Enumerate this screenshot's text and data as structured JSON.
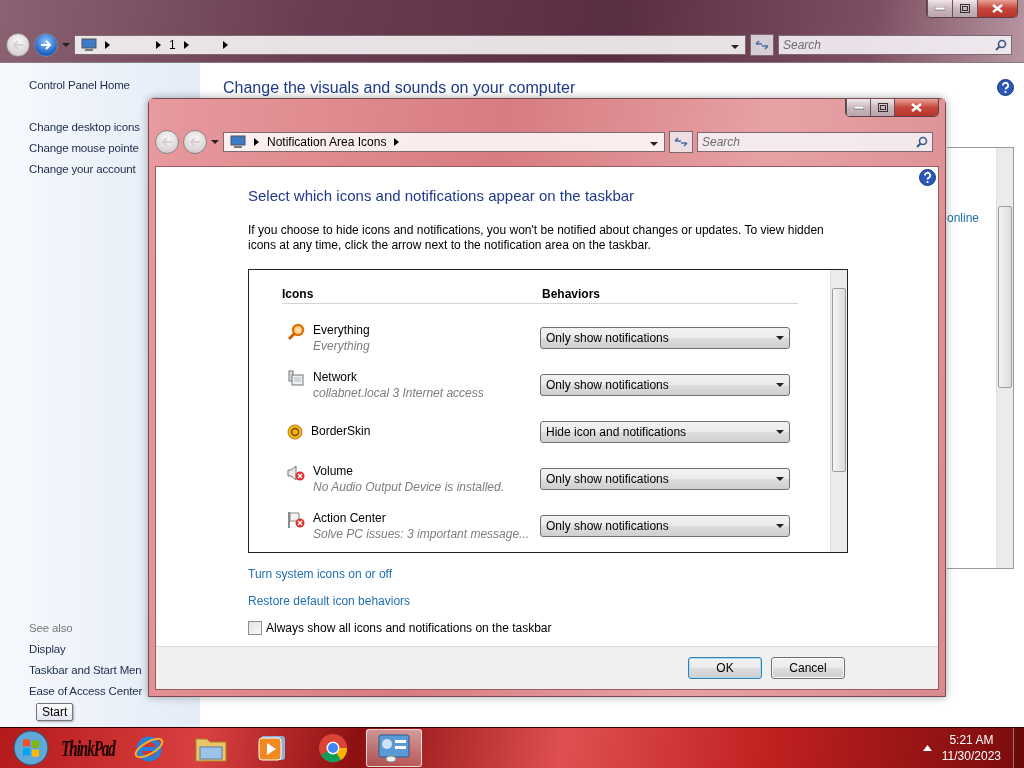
{
  "background_window": {
    "address": {
      "crumb": "1"
    },
    "search": {
      "placeholder": "Search"
    },
    "sidebar": {
      "home": "Control Panel Home",
      "links": [
        "Change desktop icons",
        "Change mouse pointe",
        "Change your account"
      ],
      "see_also_title": "See also",
      "see_also": [
        "Display",
        "Taskbar and Start Men",
        "Ease of Access Center"
      ]
    },
    "heading": "Change the visuals and sounds on your computer",
    "side_link": "online"
  },
  "dialog": {
    "address": {
      "crumb": "Notification Area Icons"
    },
    "search": {
      "placeholder": "Search"
    },
    "heading": "Select which icons and notifications appear on the taskbar",
    "intro": "If you choose to hide icons and notifications, you won't be notified about changes or updates. To view hidden icons at any time, click the arrow next to the notification area on the taskbar.",
    "columns": [
      "Icons",
      "Behaviors"
    ],
    "rows": [
      {
        "kind": "search",
        "name": "Everything",
        "detail": "Everything",
        "behavior": "Only show notifications"
      },
      {
        "kind": "network",
        "name": "Network",
        "detail": "collabnet.local  3 Internet access",
        "behavior": "Only show notifications"
      },
      {
        "kind": "coin",
        "name": "BorderSkin",
        "behavior": "Hide icon and notifications"
      },
      {
        "kind": "speaker",
        "name": "Volume",
        "detail": "No Audio Output Device is installed.",
        "behavior": "Only show notifications"
      },
      {
        "kind": "flag",
        "name": "Action Center",
        "detail": "Solve PC issues: 3 important message...",
        "behavior": "Only show notifications"
      }
    ],
    "links": [
      "Turn system icons on or off",
      "Restore default icon behaviors"
    ],
    "checkbox": {
      "label": "Always show all icons and notifications on the taskbar",
      "checked": false
    },
    "buttons": [
      {
        "label": "OK",
        "kind": "default"
      },
      {
        "label": "Cancel",
        "kind": "normal"
      }
    ]
  },
  "tooltip": "Start",
  "taskbar": {
    "apps": [
      {
        "kind": "start",
        "selected": false
      },
      {
        "kind": "thinkpad",
        "label": "ThinkPad",
        "selected": false
      },
      {
        "kind": "browser",
        "selected": false
      },
      {
        "kind": "folder",
        "selected": false
      },
      {
        "kind": "media",
        "selected": false
      },
      {
        "kind": "chrome",
        "selected": false
      },
      {
        "kind": "control-panel",
        "selected": true
      }
    ],
    "clock": {
      "time": "5:21 AM",
      "date": "11/30/2023"
    }
  }
}
